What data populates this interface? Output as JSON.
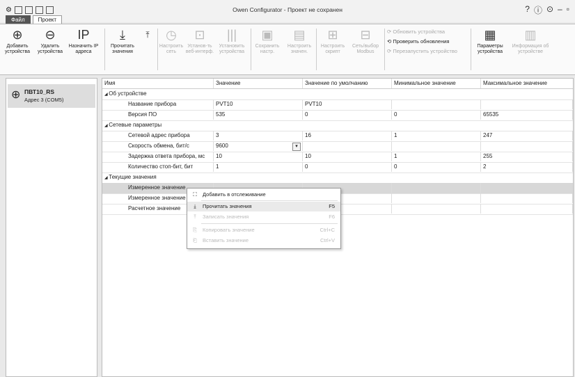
{
  "window": {
    "title": "Owen Configurator - Проект не сохранен",
    "controls": [
      "?",
      "ⓘ",
      "⊙",
      "–",
      "▫"
    ]
  },
  "tabs": [
    {
      "label": "Файл"
    },
    {
      "label": "Проект"
    }
  ],
  "ribbon": {
    "add_device": "Добавить\nустройства",
    "remove_device": "Удалить\nустройства",
    "assign_ip": "Назначить IP\nадреса",
    "read_values": "Прочитать\nзначения",
    "configure_network": "Настроить\nсеть",
    "web_interface": "Установ-ть\nвеб-интерф.",
    "update_devices": "Установить\nустройства",
    "save_settings": "Сохранить\nнастр.",
    "load_settings": "Настроить\nзначен.",
    "configure_script": "Настроить\nскрипт",
    "configure_modbus": "Сеть/выбор\nModbus",
    "update_devices_small": "Обновить устройства",
    "check_updates": "Проверить обновления",
    "reload_devices": "Перезапустить устройство",
    "device_params": "Параметры\nустройства",
    "device_info": "Информация об\nустройстве"
  },
  "device_list": [
    {
      "name": "ПВТ10_RS",
      "address": "Адрес 3 (COM5)"
    }
  ],
  "table": {
    "columns": [
      "Имя",
      "Значение",
      "Значение по умолчанию",
      "Минимальное значение",
      "Максимальное значение"
    ],
    "groups": [
      {
        "name": "Об устройстве",
        "rows": [
          {
            "name": "Название прибора",
            "value": "PVT10",
            "default": "PVT10",
            "min": "",
            "max": ""
          },
          {
            "name": "Версия ПО",
            "value": "535",
            "default": "0",
            "min": "0",
            "max": "65535"
          }
        ]
      },
      {
        "name": "Сетевые параметры",
        "rows": [
          {
            "name": "Сетевой адрес прибора",
            "value": "3",
            "default": "16",
            "min": "1",
            "max": "247"
          },
          {
            "name": "Скорость обмена, бит/с",
            "value": "9600",
            "default": "",
            "min": "",
            "max": ""
          },
          {
            "name": "Задержка ответа прибора, мс",
            "value": "10",
            "default": "10",
            "min": "1",
            "max": "255"
          },
          {
            "name": "Количество стоп-бит, бит",
            "value": "1",
            "default": "0",
            "min": "0",
            "max": "2"
          }
        ]
      },
      {
        "name": "Текущие значения",
        "rows": [
          {
            "name": "Измеренное значение",
            "value": "",
            "default": "",
            "min": "",
            "max": ""
          },
          {
            "name": "Измеренное значение",
            "value": "",
            "default": "",
            "min": "",
            "max": ""
          },
          {
            "name": "Расчетное значение",
            "value": "",
            "default": "",
            "min": "",
            "max": ""
          }
        ]
      }
    ]
  },
  "context_menu": [
    {
      "label": "Добавить в отслеживание",
      "shortcut": ""
    },
    {
      "label": "Прочитать значения",
      "shortcut": "F5"
    },
    {
      "label": "Записать значения",
      "shortcut": "F6"
    },
    {
      "label": "Копировать значение",
      "shortcut": "Ctrl+C"
    },
    {
      "label": "Вставить значение",
      "shortcut": "Ctrl+V"
    }
  ]
}
